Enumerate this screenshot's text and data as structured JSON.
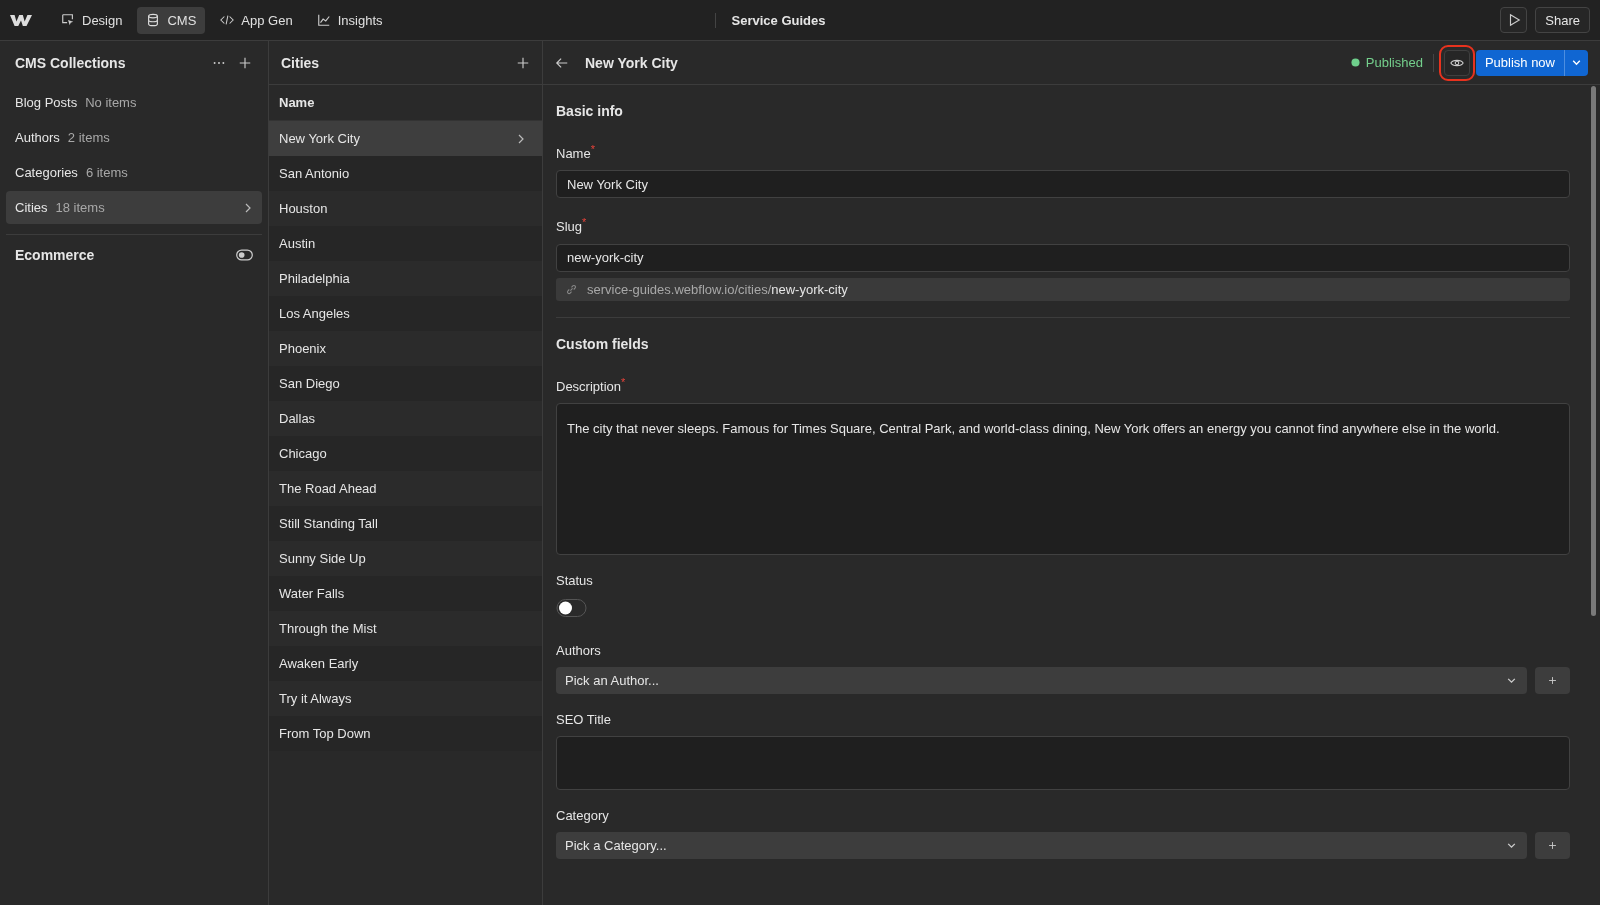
{
  "topbar": {
    "tabs": [
      {
        "label": "Design",
        "kind": "design",
        "selected": false
      },
      {
        "label": "CMS",
        "kind": "cms",
        "selected": true
      },
      {
        "label": "App Gen",
        "kind": "code",
        "selected": false
      },
      {
        "label": "Insights",
        "kind": "chart",
        "selected": false
      }
    ],
    "site_name": "Service Guides",
    "share": "Share"
  },
  "collections": {
    "title": "CMS Collections",
    "items": [
      {
        "name": "Blog Posts",
        "count": "No items",
        "selected": false
      },
      {
        "name": "Authors",
        "count": "2 items",
        "selected": false
      },
      {
        "name": "Categories",
        "count": "6 items",
        "selected": false
      },
      {
        "name": "Cities",
        "count": "18 items",
        "selected": true
      }
    ],
    "ecommerce": {
      "label": "Ecommerce",
      "on": false
    }
  },
  "list": {
    "title": "Cities",
    "column": "Name",
    "rows": [
      {
        "name": "New York City",
        "selected": true
      },
      {
        "name": "San Antonio",
        "selected": false
      },
      {
        "name": "Houston",
        "selected": false
      },
      {
        "name": "Austin",
        "selected": false
      },
      {
        "name": "Philadelphia",
        "selected": false
      },
      {
        "name": "Los Angeles",
        "selected": false
      },
      {
        "name": "Phoenix",
        "selected": false
      },
      {
        "name": "San Diego",
        "selected": false
      },
      {
        "name": "Dallas",
        "selected": false
      },
      {
        "name": "Chicago",
        "selected": false
      },
      {
        "name": "The Road Ahead",
        "selected": false
      },
      {
        "name": "Still Standing Tall",
        "selected": false
      },
      {
        "name": "Sunny Side Up",
        "selected": false
      },
      {
        "name": "Water Falls",
        "selected": false
      },
      {
        "name": "Through the Mist",
        "selected": false
      },
      {
        "name": "Awaken Early",
        "selected": false
      },
      {
        "name": "Try it Always",
        "selected": false
      },
      {
        "name": "From Top Down",
        "selected": false
      }
    ]
  },
  "editor": {
    "title": "New York City",
    "status": "Published",
    "preview_highlighted": true,
    "publish": "Publish now",
    "basic_title": "Basic info",
    "name": {
      "label": "Name",
      "required_mark": "*",
      "value": "New York City"
    },
    "slug": {
      "label": "Slug",
      "required_mark": "*",
      "value": "new-york-city",
      "url_base": "service-guides.webflow.io/cities/",
      "url_slug": "new-york-city"
    },
    "custom_title": "Custom fields",
    "fields": [
      {
        "kind": "textarea",
        "label": "Description",
        "required_mark": "*",
        "value": "The city that never sleeps. Famous for Times Square, Central Park, and world-class dining, New York offers an energy you cannot find anywhere else in the world.",
        "tall": true
      },
      {
        "kind": "switch",
        "label": "Status",
        "on": false
      },
      {
        "kind": "select",
        "label": "Authors",
        "placeholder": "Pick an Author..."
      },
      {
        "kind": "textarea",
        "label": "SEO Title",
        "tall": false
      },
      {
        "kind": "select",
        "label": "Category",
        "placeholder": "Pick a Category..."
      }
    ]
  }
}
